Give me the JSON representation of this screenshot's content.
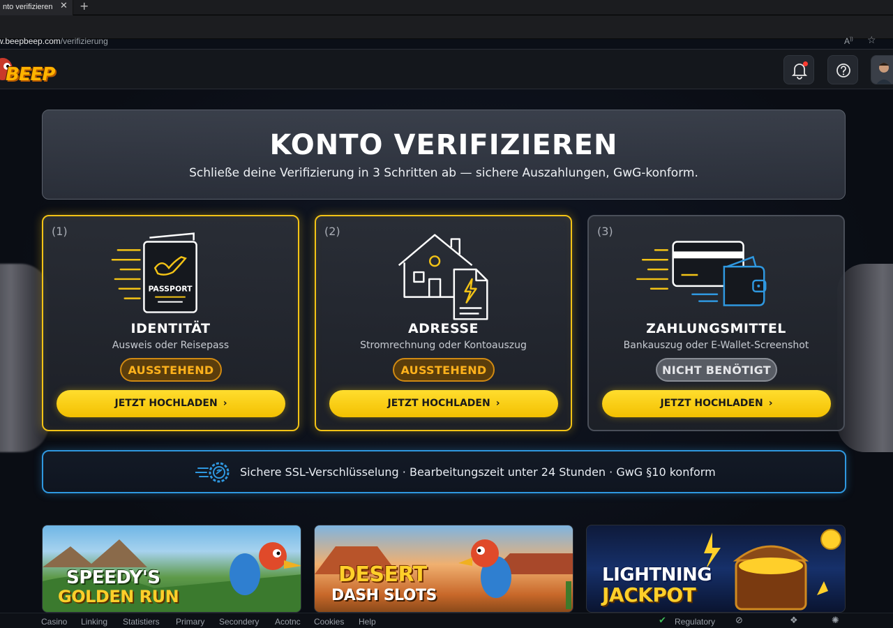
{
  "browser": {
    "tab_title": "nto verifizieren",
    "url_host": "w.beepbeep.com",
    "url_path": "/verifizierung"
  },
  "header": {
    "logo_text": "BEEP"
  },
  "hero": {
    "title": "KONTO VERIFIZIEREN",
    "subtitle": "Schließe deine Verifizierung in 3 Schritten ab — sichere Auszahlungen, GwG-konform."
  },
  "steps": [
    {
      "num": "(1)",
      "title": "IDENTITÄT",
      "desc": "Ausweis oder Reisepass",
      "status": "AUSSTEHEND",
      "button": "JETZT HOCHLADEN",
      "doc_label": "PASSPORT"
    },
    {
      "num": "(2)",
      "title": "ADRESSE",
      "desc": "Stromrechnung oder Kontoauszug",
      "status": "AUSSTEHEND",
      "button": "JETZT HOCHLADEN"
    },
    {
      "num": "(3)",
      "title": "ZAHLUNGSMITTEL",
      "desc": "Bankauszug oder E-Wallet-Screenshot",
      "status": "NICHT BENÖTIGT",
      "button": "JETZT HOCHLADEN"
    }
  ],
  "info": {
    "text": "Sichere SSL-Verschlüsselung · Bearbeitungszeit unter 24 Stunden · GwG §10 konform"
  },
  "games": [
    {
      "line1": "SPEEDY'S",
      "line2": "GOLDEN RUN"
    },
    {
      "line1": "DESERT",
      "line2": "DASH SLOTS"
    },
    {
      "line1": "LIGHTNING",
      "line2": "JACKPOT"
    }
  ],
  "footer": {
    "links": [
      "Casino",
      "Linking",
      "Statistiers",
      "Primary",
      "Secondery",
      "Acotnc",
      "Cookies",
      "Help"
    ],
    "regulatory": "Regulatory"
  },
  "colors": {
    "accent_yellow": "#f3c316",
    "pending_orange": "#ffb21c",
    "info_blue": "#2f98e0"
  },
  "icons": [
    "bell-icon",
    "help-icon",
    "passport-icon",
    "house-icon",
    "card-wallet-icon",
    "shield-gear-icon",
    "chevron-right-icon",
    "star-icon"
  ]
}
